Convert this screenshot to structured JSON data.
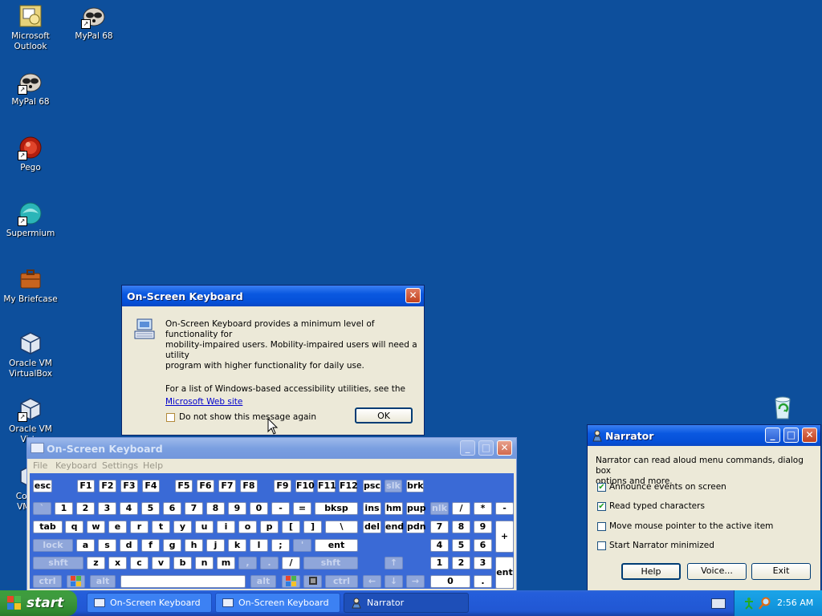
{
  "desktop": {
    "icons": [
      {
        "label_lines": [
          "Microsoft",
          "Outlook"
        ],
        "icon": "outlook-icon"
      },
      {
        "label_lines": [
          "MyPal 68"
        ],
        "icon": "raccoon-icon"
      },
      {
        "label_lines": [
          "MyPal 68"
        ],
        "icon": "raccoon-icon"
      },
      {
        "label_lines": [
          "Pego"
        ],
        "icon": "pego-icon"
      },
      {
        "label_lines": [
          "Supermium"
        ],
        "icon": "supermium-icon"
      },
      {
        "label_lines": [
          "My Briefcase"
        ],
        "icon": "briefcase-icon"
      },
      {
        "label_lines": [
          "Oracle VM",
          "VirtualBox"
        ],
        "icon": "virtualbox-icon"
      },
      {
        "label_lines": [
          "Oracle VM",
          "Virtu"
        ],
        "icon": "virtualbox-icon"
      },
      {
        "label_lines": [
          "Copy o",
          "VM Vir"
        ],
        "icon": "virtualbox-icon"
      }
    ],
    "recycle_bin_icon": "recycle-bin-icon"
  },
  "dialog": {
    "title": "On-Screen Keyboard",
    "message_line1": "On-Screen Keyboard provides a minimum level of functionality for",
    "message_line2": "mobility-impaired users. Mobility-impaired users will need a utility",
    "message_line3": "program with higher functionality for daily use.",
    "list_line": "For a list of Windows-based accessibility utilities, see the",
    "link": "Microsoft Web site",
    "checkbox_label": "Do not show this message again",
    "checkbox_checked": false,
    "ok": "OK"
  },
  "keyboard_window": {
    "title": "On-Screen Keyboard",
    "menu": [
      "File",
      "Keyboard",
      "Settings",
      "Help"
    ],
    "rows": {
      "fn": [
        "esc",
        "F1",
        "F2",
        "F3",
        "F4",
        "F5",
        "F6",
        "F7",
        "F8",
        "F9",
        "F10",
        "F11",
        "F12",
        "psc",
        "slk",
        "brk"
      ],
      "num": [
        "`",
        "1",
        "2",
        "3",
        "4",
        "5",
        "6",
        "7",
        "8",
        "9",
        "0",
        "-",
        "=",
        "bksp",
        "ins",
        "hm",
        "pup",
        "nlk",
        "/",
        "*",
        "-"
      ],
      "tab": [
        "tab",
        "q",
        "w",
        "e",
        "r",
        "t",
        "y",
        "u",
        "i",
        "o",
        "p",
        "[",
        "]",
        "\\",
        "del",
        "end",
        "pdn",
        "7",
        "8",
        "9",
        "+"
      ],
      "caps": [
        "lock",
        "a",
        "s",
        "d",
        "f",
        "g",
        "h",
        "j",
        "k",
        "l",
        ";",
        "'",
        "ent",
        "4",
        "5",
        "6"
      ],
      "shift": [
        "shft",
        "z",
        "x",
        "c",
        "v",
        "b",
        "n",
        "m",
        ",",
        ".",
        "/",
        "shft",
        "↑",
        "1",
        "2",
        "3",
        "ent"
      ],
      "ctrl": [
        "ctrl",
        "",
        "alt",
        "",
        "alt",
        "",
        "",
        "ctrl",
        "←",
        "↓",
        "→",
        "0",
        "."
      ]
    }
  },
  "narrator": {
    "title": "Narrator",
    "description_line1": "Narrator can read aloud menu commands, dialog box",
    "description_line2": "options and more.",
    "options": [
      {
        "label": "Announce events on screen",
        "checked": true
      },
      {
        "label": "Read typed characters",
        "checked": true
      },
      {
        "label": "Move mouse pointer to the active item",
        "checked": false
      },
      {
        "label": "Start Narrator minimized",
        "checked": false
      }
    ],
    "buttons": {
      "help": "Help",
      "voice": "Voice...",
      "exit": "Exit"
    }
  },
  "taskbar": {
    "start": "start",
    "tasks": [
      {
        "label": "On-Screen Keyboard",
        "active": false
      },
      {
        "label": "On-Screen Keyboard",
        "active": false
      },
      {
        "label": "Narrator",
        "active": true
      }
    ],
    "clock": "2:56 AM"
  },
  "colors": {
    "desktop": "#0d4f9c",
    "titlebar_active": "#0a58e0",
    "window_face": "#ece9d8",
    "keyboard_bg": "#3a6ad6"
  }
}
